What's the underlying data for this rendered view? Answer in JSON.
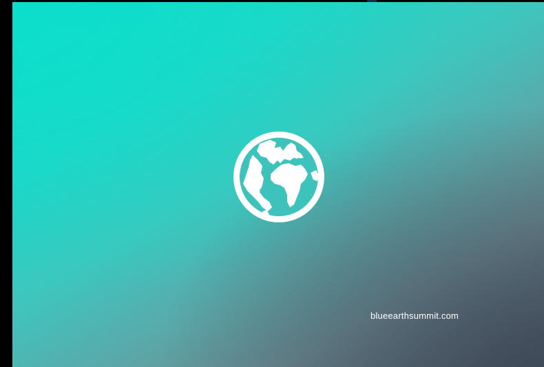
{
  "slide": {
    "logo_icon": "globe-icon",
    "website": "blueearthsummit.com"
  },
  "colors": {
    "gradient_start": "#0bdccb",
    "gradient_end": "#44505c",
    "text": "#ffffff"
  }
}
